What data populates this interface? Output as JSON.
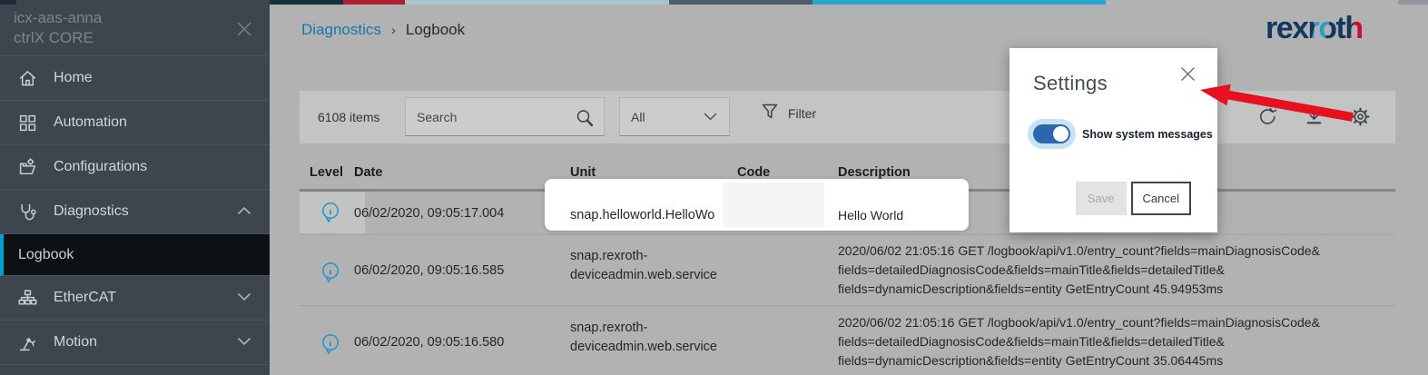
{
  "window": {
    "device_name": "icx-aas-anna",
    "product_name": "ctrlX CORE"
  },
  "sidebar": {
    "items": [
      {
        "label": "Home",
        "icon": "home-icon"
      },
      {
        "label": "Automation",
        "icon": "automation-icon"
      },
      {
        "label": "Configurations",
        "icon": "configurations-icon"
      },
      {
        "label": "Diagnostics",
        "icon": "diagnostics-icon",
        "expanded": true
      },
      {
        "label": "EtherCAT",
        "icon": "ethercat-icon",
        "expanded": false
      },
      {
        "label": "Motion",
        "icon": "motion-icon",
        "expanded": false
      }
    ],
    "active_subitem": "Logbook"
  },
  "breadcrumb": {
    "parent": "Diagnostics",
    "separator": "›",
    "current": "Logbook"
  },
  "brand": {
    "logo_text": "rexroth"
  },
  "toolbar": {
    "items_count": "6108 items",
    "search_placeholder": "Search",
    "scope_selected": "All",
    "filter_label": "Filter",
    "action_icons": [
      "refresh-icon",
      "download-icon",
      "settings-gear-icon"
    ]
  },
  "settings_dialog": {
    "title": "Settings",
    "toggle_label": "Show system messages",
    "toggle_on": true,
    "save_label": "Save",
    "cancel_label": "Cancel"
  },
  "table": {
    "headers": [
      "Level",
      "Date",
      "Unit",
      "Code",
      "Description"
    ],
    "rows": [
      {
        "level": "info",
        "date": "06/02/2020, 09:05:17.004",
        "unit": "snap.helloworld.HelloWo",
        "code": "",
        "description_lines": [
          "Hello World"
        ]
      },
      {
        "level": "info",
        "date": "06/02/2020, 09:05:16.585",
        "unit": "snap.rexroth-deviceadmin.web.service",
        "code": "",
        "description_lines": [
          "2020/06/02 21:05:16 GET /logbook/api/v1.0/entry_count?fields=mainDiagnosisCode&",
          "fields=detailedDiagnosisCode&fields=mainTitle&fields=detailedTitle&",
          "fields=dynamicDescription&fields=entity GetEntryCount 45.94953ms"
        ]
      },
      {
        "level": "info",
        "date": "06/02/2020, 09:05:16.580",
        "unit": "snap.rexroth-deviceadmin.web.service",
        "code": "",
        "description_lines": [
          "2020/06/02 21:05:16 GET /logbook/api/v1.0/entry_count?fields=mainDiagnosisCode&",
          "fields=detailedDiagnosisCode&fields=mainTitle&fields=detailedTitle&",
          "fields=dynamicDescription&fields=entity GetEntryCount 35.06445ms"
        ]
      }
    ]
  },
  "colors": {
    "sidebar_bg": "#3d454f",
    "active_accent_cyan": "#009fd4",
    "info_icon_blue": "#2e96c8",
    "breadcrumb_blue": "#1478aa",
    "toggle_blue": "#2b67ae",
    "annotation_arrow_red": "#e6101f",
    "logo_navy": "#143760",
    "logo_red": "#cc0f2f",
    "page_dim_gray": "#b2b2b3"
  }
}
